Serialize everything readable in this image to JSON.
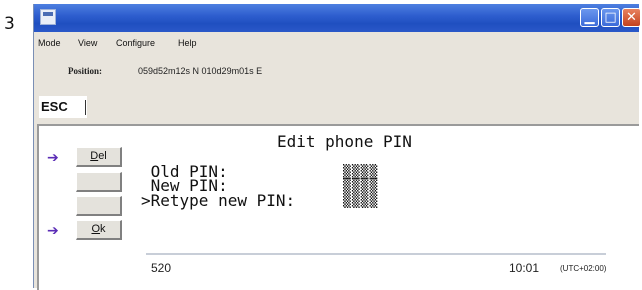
{
  "step_number": "3",
  "window": {
    "title": ""
  },
  "menu": [
    "Mode",
    "View",
    "Configure",
    "Help"
  ],
  "position": {
    "label": "Position:",
    "value": "059d52m12s N 010d29m01s E"
  },
  "esc_label": "ESC",
  "softkeys": {
    "del": {
      "prefix": "",
      "underlined": "D",
      "rest": "el"
    },
    "blank1": "",
    "blank2": "",
    "ok": {
      "underlined": "O",
      "rest": "k"
    }
  },
  "screen": {
    "title": "Edit phone PIN",
    "fields": [
      {
        "label": " Old PIN:",
        "value": "▒▒▒▒"
      },
      {
        "label": " New PIN:",
        "value": "▒▒▒▒"
      },
      {
        "label": ">Retype new PIN:",
        "value": "▒▒▒▒"
      }
    ]
  },
  "status": {
    "left": "520",
    "time": "10:01",
    "timezone": "(UTC+02:00)"
  },
  "colors": {
    "titlebar": "#2f5fcf",
    "arrow": "#5b2db6",
    "close": "#c4421e"
  },
  "icons": {
    "arrow": "right-arrow-icon"
  }
}
